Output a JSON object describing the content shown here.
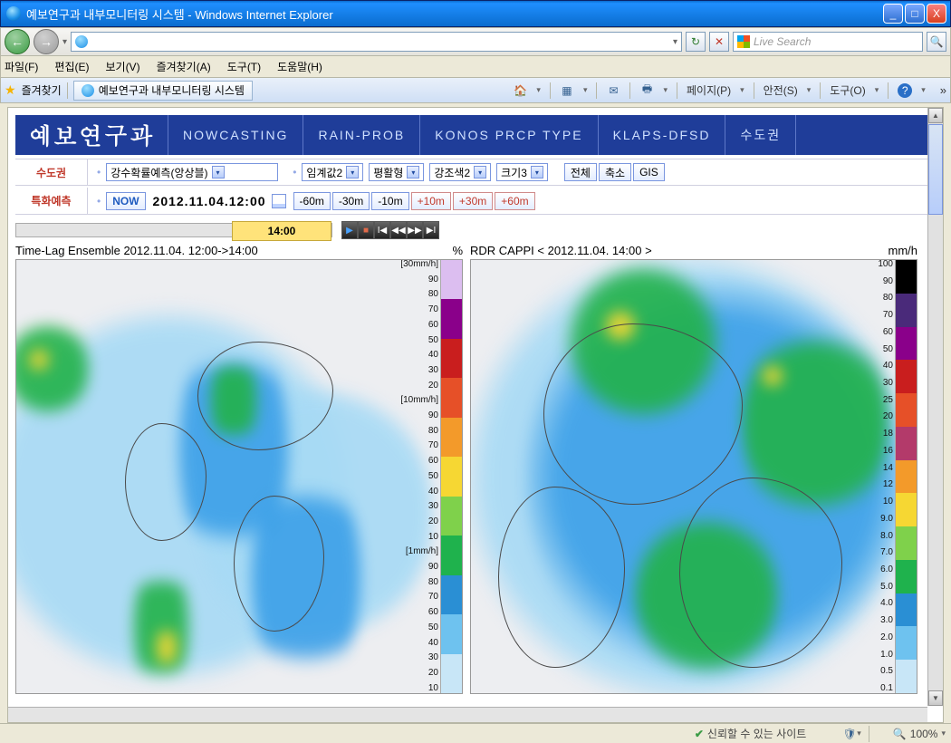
{
  "window": {
    "title": "예보연구과 내부모니터링 시스템 - Windows Internet Explorer",
    "min": "_",
    "max": "□",
    "close": "X"
  },
  "nav": {
    "back": "←",
    "fwd": "→",
    "refresh": "↻",
    "stop": "✕",
    "go": "→",
    "search_placeholder": "Live Search",
    "search_go": "🔍"
  },
  "menu": {
    "items": [
      "파일(F)",
      "편집(E)",
      "보기(V)",
      "즐겨찾기(A)",
      "도구(T)",
      "도움말(H)"
    ]
  },
  "tabbar": {
    "fav": "즐겨찾기",
    "tab_label": "예보연구과 내부모니터링 시스템",
    "tools": [
      "페이지(P)",
      "안전(S)",
      "도구(O)"
    ]
  },
  "header": {
    "brand": "예보연구과",
    "nav": [
      "NOWCASTING",
      "RAIN-PROB",
      "KONOS PRCP TYPE",
      "KLAPS-DFSD",
      "수도권"
    ]
  },
  "side": {
    "line1": "수도권",
    "line2": "특화예측"
  },
  "row1": {
    "sel_product": "강수확률예측(앙상블)",
    "sel_thresh": "임계값2",
    "sel_smooth": "평활형",
    "sel_color": "강조색2",
    "sel_size": "크기3",
    "btn_full": "전체",
    "btn_small": "축소",
    "btn_gis": "GIS"
  },
  "row2": {
    "now": "NOW",
    "datetime": "2012.11.04.12:00",
    "steps": [
      "-60m",
      "-30m",
      "-10m",
      "+10m",
      "+30m",
      "+60m"
    ]
  },
  "timeline": {
    "cursor": "14:00"
  },
  "chart_left": {
    "title": "Time-Lag Ensemble 2012.11.04. 12:00->14:00",
    "unit": "%",
    "legend": [
      "[30mm/h]",
      "90",
      "80",
      "70",
      "60",
      "50",
      "40",
      "30",
      "20",
      "[10mm/h]",
      "90",
      "80",
      "70",
      "60",
      "50",
      "40",
      "30",
      "20",
      "10",
      "[1mm/h]",
      "90",
      "80",
      "70",
      "60",
      "50",
      "40",
      "30",
      "20",
      "10"
    ]
  },
  "chart_right": {
    "title": "RDR CAPPI < 2012.11.04. 14:00 >",
    "unit": "mm/h",
    "legend": [
      "100",
      "90",
      "80",
      "70",
      "60",
      "50",
      "40",
      "30",
      "25",
      "20",
      "18",
      "16",
      "14",
      "12",
      "10",
      "9.0",
      "8.0",
      "7.0",
      "6.0",
      "5.0",
      "4.0",
      "3.0",
      "2.0",
      "1.0",
      "0.5",
      "0.1"
    ]
  },
  "status": {
    "trusted": "신뢰할 수 있는 사이트",
    "zoom": "100%"
  },
  "chart_data": [
    {
      "type": "heatmap",
      "title": "Time-Lag Ensemble 2012.11.04. 12:00->14:00",
      "unit": "%",
      "description": "Probability-of-precipitation ensemble map over Seoul metro region",
      "value_range": [
        10,
        90
      ],
      "thresholds_mm_per_h": [
        1,
        10,
        30
      ],
      "colorbar": [
        "#c8e6f7",
        "#6ec2ef",
        "#2a8fd4",
        "#1fb24d",
        "#7fd14b",
        "#f6d733",
        "#f39a2a",
        "#e65028",
        "#c91e1e",
        "#8a008a",
        "#dcbef0"
      ]
    },
    {
      "type": "heatmap",
      "title": "RDR CAPPI 2012.11.04. 14:00",
      "unit": "mm/h",
      "description": "Radar CAPPI rain-rate over Korean peninsula",
      "value_range": [
        0.1,
        100
      ],
      "colorbar": [
        "#c8e6f7",
        "#6ec2ef",
        "#2a8fd4",
        "#1fb24d",
        "#7fd14b",
        "#f6d733",
        "#f39a2a",
        "#e65028",
        "#c91e1e",
        "#8a008a",
        "#dcbef0",
        "#000"
      ]
    }
  ]
}
